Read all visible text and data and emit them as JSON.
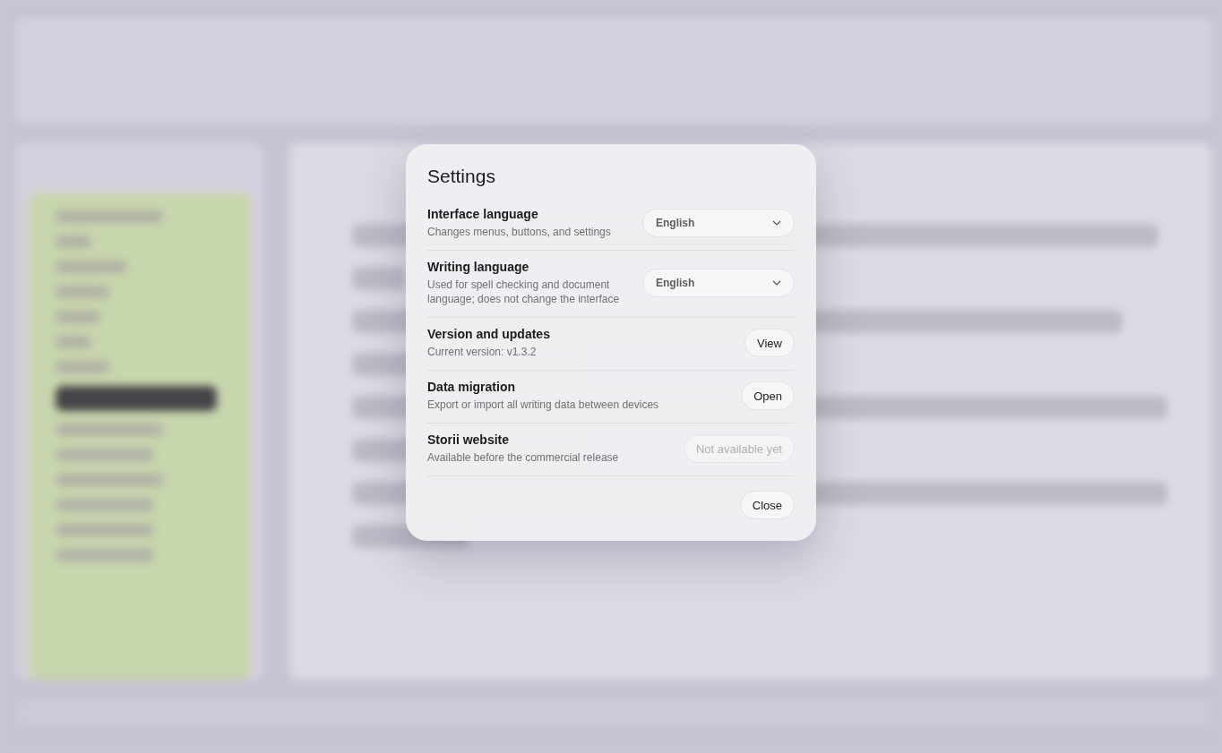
{
  "dialog": {
    "title": "Settings",
    "rows": [
      {
        "kind": "select",
        "label": "Interface language",
        "description": "Changes menus, buttons, and settings",
        "value": "English"
      },
      {
        "kind": "select",
        "label": "Writing language",
        "description": "Used for spell checking and document language; does not change the interface",
        "value": "English"
      },
      {
        "kind": "button",
        "label": "Version and updates",
        "description": "Current version: v1.3.2",
        "action": "View",
        "disabled": false
      },
      {
        "kind": "button",
        "label": "Data migration",
        "description": "Export or import all writing data between devices",
        "action": "Open",
        "disabled": false
      },
      {
        "kind": "button",
        "label": "Storii website",
        "description": "Available before the commercial release",
        "action": "Not available yet",
        "disabled": true
      }
    ],
    "close": "Close"
  }
}
